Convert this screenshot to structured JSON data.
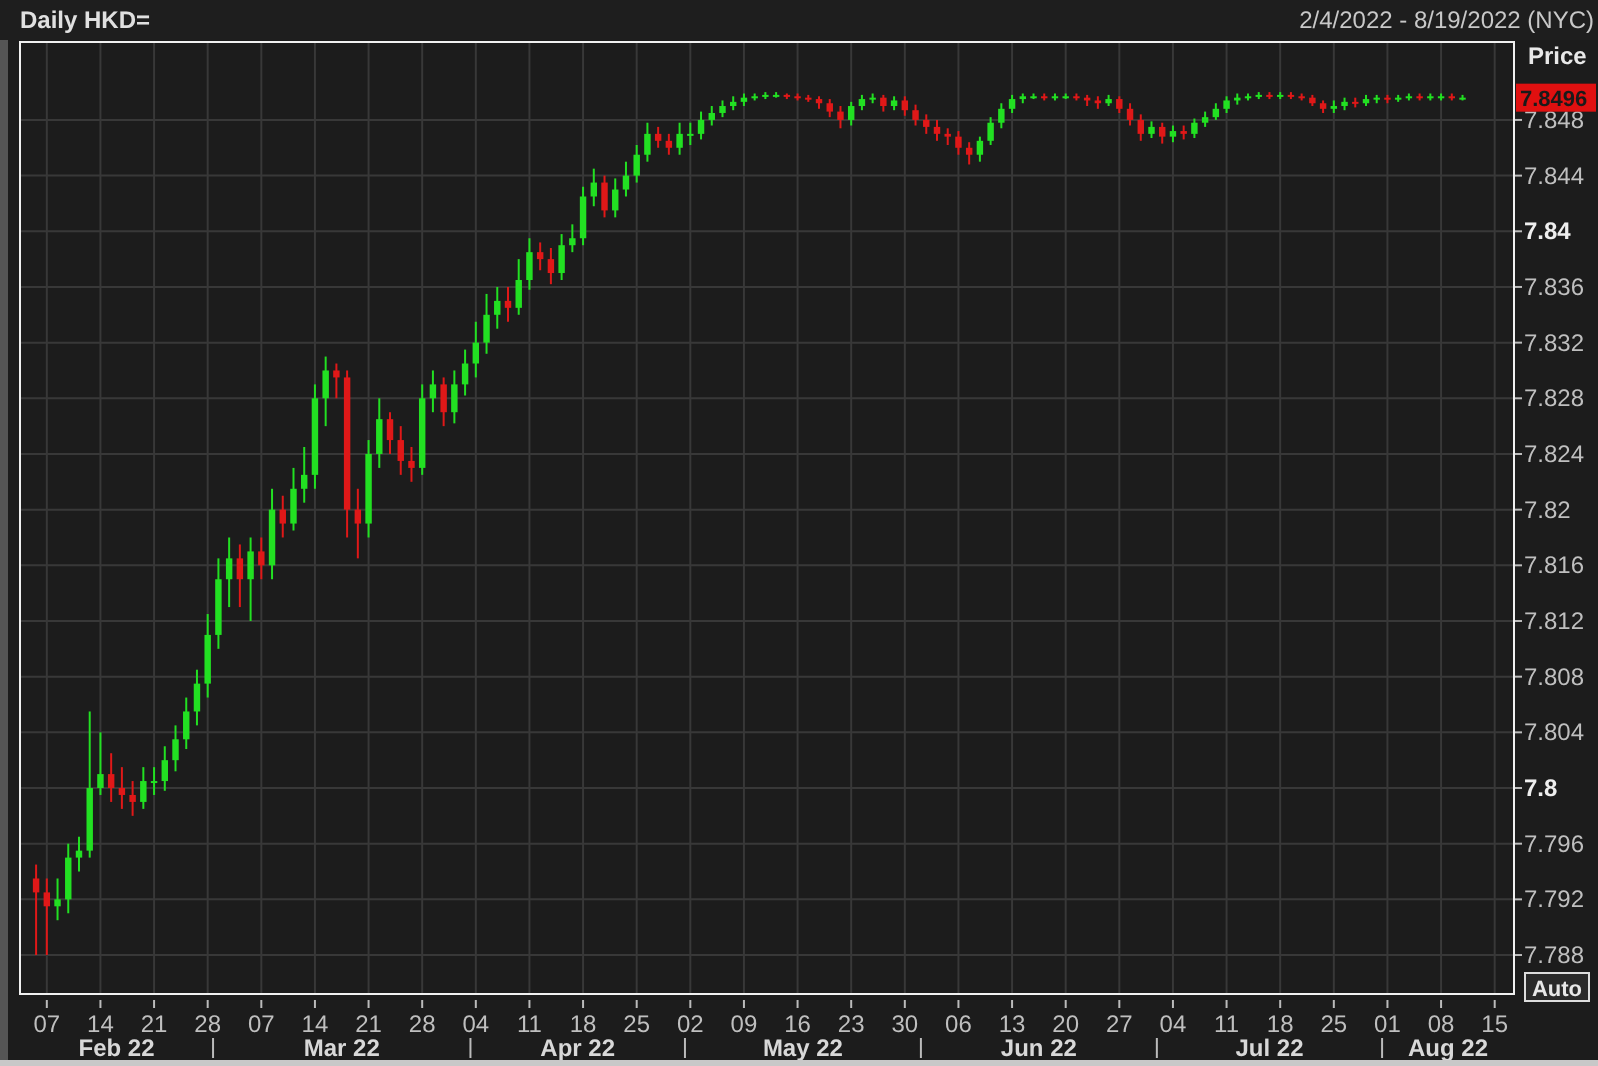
{
  "header": {
    "title": "Daily HKD=",
    "range": "2/4/2022 - 8/19/2022 (NYC)"
  },
  "chart": {
    "axis_title": "Price",
    "last_price": "7.8496",
    "auto_button": "Auto",
    "chart_data": {
      "type": "candlestick",
      "ylim": [
        7.7852,
        7.8536
      ],
      "yticks": [
        {
          "value": 7.788,
          "label": "7.788"
        },
        {
          "value": 7.792,
          "label": "7.792"
        },
        {
          "value": 7.796,
          "label": "7.796"
        },
        {
          "value": 7.8,
          "label": "7.8"
        },
        {
          "value": 7.804,
          "label": "7.804"
        },
        {
          "value": 7.808,
          "label": "7.808"
        },
        {
          "value": 7.812,
          "label": "7.812"
        },
        {
          "value": 7.816,
          "label": "7.816"
        },
        {
          "value": 7.82,
          "label": "7.82"
        },
        {
          "value": 7.824,
          "label": "7.824"
        },
        {
          "value": 7.828,
          "label": "7.828"
        },
        {
          "value": 7.832,
          "label": "7.832"
        },
        {
          "value": 7.836,
          "label": "7.836"
        },
        {
          "value": 7.84,
          "label": "7.84"
        },
        {
          "value": 7.844,
          "label": "7.844"
        },
        {
          "value": 7.848,
          "label": "7.848"
        }
      ],
      "categories": [
        null,
        "07",
        null,
        null,
        null,
        null,
        "14",
        null,
        null,
        null,
        null,
        "21",
        null,
        null,
        null,
        null,
        "28",
        null,
        null,
        null,
        null,
        "07",
        null,
        null,
        null,
        null,
        "14",
        null,
        null,
        null,
        null,
        "21",
        null,
        null,
        null,
        null,
        "28",
        null,
        null,
        null,
        null,
        "04",
        null,
        null,
        null,
        null,
        "11",
        null,
        null,
        null,
        null,
        "18",
        null,
        null,
        null,
        null,
        "25",
        null,
        null,
        null,
        null,
        "02",
        null,
        null,
        null,
        null,
        "09",
        null,
        null,
        null,
        null,
        "16",
        null,
        null,
        null,
        null,
        "23",
        null,
        null,
        null,
        null,
        "30",
        null,
        null,
        null,
        null,
        "06",
        null,
        null,
        null,
        null,
        "13",
        null,
        null,
        null,
        null,
        "20",
        null,
        null,
        null,
        null,
        "27",
        null,
        null,
        null,
        null,
        "04",
        null,
        null,
        null,
        null,
        "11",
        null,
        null,
        null,
        null,
        "18",
        null,
        null,
        null,
        null,
        "25",
        null,
        null,
        null,
        null,
        "01",
        null,
        null,
        null,
        null,
        "08",
        null,
        null,
        null,
        null,
        "15"
      ],
      "grid": true,
      "annotations": [
        "Feb 22",
        "Mar 22",
        "Apr 22",
        "May 22",
        "Jun 22",
        "Jul 22",
        "Aug 22"
      ],
      "ohlc": [
        [
          7.7935,
          7.7945,
          7.788,
          7.7925
        ],
        [
          7.7925,
          7.7935,
          7.788,
          7.7915
        ],
        [
          7.7915,
          7.7935,
          7.7905,
          7.792
        ],
        [
          7.792,
          7.796,
          7.791,
          7.795
        ],
        [
          7.795,
          7.7965,
          7.794,
          7.7955
        ],
        [
          7.7955,
          7.8055,
          7.795,
          7.8
        ],
        [
          7.8,
          7.804,
          7.7995,
          7.801
        ],
        [
          7.801,
          7.8025,
          7.799,
          7.8
        ],
        [
          7.8,
          7.8015,
          7.7985,
          7.7995
        ],
        [
          7.7995,
          7.8005,
          7.798,
          7.799
        ],
        [
          7.799,
          7.8015,
          7.7985,
          7.8005
        ],
        [
          7.8005,
          7.8015,
          7.7995,
          7.8005
        ],
        [
          7.8005,
          7.803,
          7.7998,
          7.802
        ],
        [
          7.802,
          7.8045,
          7.8012,
          7.8035
        ],
        [
          7.8035,
          7.8065,
          7.8028,
          7.8055
        ],
        [
          7.8055,
          7.8085,
          7.8045,
          7.8075
        ],
        [
          7.8075,
          7.8125,
          7.8065,
          7.811
        ],
        [
          7.811,
          7.8165,
          7.81,
          7.815
        ],
        [
          7.815,
          7.818,
          7.813,
          7.8165
        ],
        [
          7.8165,
          7.8175,
          7.813,
          7.815
        ],
        [
          7.815,
          7.818,
          7.812,
          7.817
        ],
        [
          7.817,
          7.818,
          7.815,
          7.816
        ],
        [
          7.816,
          7.8215,
          7.815,
          7.82
        ],
        [
          7.82,
          7.821,
          7.818,
          7.819
        ],
        [
          7.819,
          7.823,
          7.8185,
          7.8215
        ],
        [
          7.8215,
          7.8245,
          7.8205,
          7.8225
        ],
        [
          7.8225,
          7.829,
          7.8215,
          7.828
        ],
        [
          7.828,
          7.831,
          7.826,
          7.83
        ],
        [
          7.83,
          7.8305,
          7.828,
          7.8295
        ],
        [
          7.8295,
          7.83,
          7.818,
          7.82
        ],
        [
          7.82,
          7.8215,
          7.8165,
          7.819
        ],
        [
          7.819,
          7.825,
          7.818,
          7.824
        ],
        [
          7.824,
          7.828,
          7.823,
          7.8265
        ],
        [
          7.8265,
          7.827,
          7.824,
          7.825
        ],
        [
          7.825,
          7.826,
          7.8225,
          7.8235
        ],
        [
          7.8235,
          7.8245,
          7.822,
          7.823
        ],
        [
          7.823,
          7.829,
          7.8225,
          7.828
        ],
        [
          7.828,
          7.83,
          7.827,
          7.829
        ],
        [
          7.829,
          7.8295,
          7.826,
          7.827
        ],
        [
          7.827,
          7.83,
          7.8262,
          7.829
        ],
        [
          7.829,
          7.8315,
          7.8282,
          7.8305
        ],
        [
          7.8305,
          7.8335,
          7.8295,
          7.832
        ],
        [
          7.832,
          7.8355,
          7.8312,
          7.834
        ],
        [
          7.834,
          7.836,
          7.833,
          7.835
        ],
        [
          7.835,
          7.836,
          7.8335,
          7.8345
        ],
        [
          7.8345,
          7.838,
          7.834,
          7.8365
        ],
        [
          7.8365,
          7.8395,
          7.8358,
          7.8385
        ],
        [
          7.8385,
          7.8392,
          7.8372,
          7.838
        ],
        [
          7.838,
          7.8388,
          7.8362,
          7.837
        ],
        [
          7.837,
          7.8398,
          7.8365,
          7.839
        ],
        [
          7.839,
          7.8405,
          7.8385,
          7.8395
        ],
        [
          7.8395,
          7.8432,
          7.839,
          7.8425
        ],
        [
          7.8425,
          7.8445,
          7.8418,
          7.8435
        ],
        [
          7.8435,
          7.844,
          7.841,
          7.8415
        ],
        [
          7.8415,
          7.8438,
          7.841,
          7.843
        ],
        [
          7.843,
          7.845,
          7.8425,
          7.844
        ],
        [
          7.844,
          7.8462,
          7.8435,
          7.8455
        ],
        [
          7.8455,
          7.8478,
          7.845,
          7.847
        ],
        [
          7.847,
          7.8475,
          7.846,
          7.8465
        ],
        [
          7.8465,
          7.847,
          7.8455,
          7.846
        ],
        [
          7.846,
          7.8478,
          7.8455,
          7.847
        ],
        [
          7.847,
          7.8478,
          7.8462,
          7.847
        ],
        [
          7.847,
          7.8486,
          7.8466,
          7.848
        ],
        [
          7.848,
          7.849,
          7.8476,
          7.8485
        ],
        [
          7.8485,
          7.8494,
          7.8482,
          7.849
        ],
        [
          7.849,
          7.8497,
          7.8487,
          7.8493
        ],
        [
          7.8493,
          7.8499,
          7.849,
          7.8496
        ],
        [
          7.8496,
          7.8499,
          7.8494,
          7.8497
        ],
        [
          7.8497,
          7.85,
          7.8495,
          7.8498
        ],
        [
          7.8498,
          7.85,
          7.8496,
          7.8498
        ],
        [
          7.8498,
          7.8499,
          7.8495,
          7.8497
        ],
        [
          7.8497,
          7.8499,
          7.8494,
          7.8496
        ],
        [
          7.8496,
          7.8498,
          7.8493,
          7.8495
        ],
        [
          7.8495,
          7.8497,
          7.8488,
          7.8492
        ],
        [
          7.8492,
          7.8495,
          7.8482,
          7.8486
        ],
        [
          7.8486,
          7.849,
          7.8474,
          7.848
        ],
        [
          7.848,
          7.8493,
          7.8476,
          7.849
        ],
        [
          7.849,
          7.8498,
          7.8487,
          7.8495
        ],
        [
          7.8495,
          7.8499,
          7.8492,
          7.8496
        ],
        [
          7.8496,
          7.8498,
          7.8486,
          7.849
        ],
        [
          7.849,
          7.8497,
          7.8487,
          7.8494
        ],
        [
          7.8494,
          7.8497,
          7.8483,
          7.8487
        ],
        [
          7.8487,
          7.8491,
          7.8476,
          7.848
        ],
        [
          7.848,
          7.8484,
          7.847,
          7.8475
        ],
        [
          7.8475,
          7.848,
          7.8465,
          7.847
        ],
        [
          7.847,
          7.8474,
          7.8462,
          7.8468
        ],
        [
          7.8468,
          7.8472,
          7.8455,
          7.846
        ],
        [
          7.846,
          7.8464,
          7.8448,
          7.8455
        ],
        [
          7.8455,
          7.8468,
          7.845,
          7.8465
        ],
        [
          7.8465,
          7.8482,
          7.8462,
          7.8478
        ],
        [
          7.8478,
          7.8492,
          7.8474,
          7.8488
        ],
        [
          7.8488,
          7.8498,
          7.8485,
          7.8495
        ],
        [
          7.8495,
          7.8499,
          7.8492,
          7.8497
        ],
        [
          7.8497,
          7.8499,
          7.8495,
          7.8497
        ],
        [
          7.8497,
          7.8499,
          7.8494,
          7.8496
        ],
        [
          7.8496,
          7.8499,
          7.8494,
          7.8497
        ],
        [
          7.8497,
          7.8499,
          7.8495,
          7.8497
        ],
        [
          7.8497,
          7.8499,
          7.8494,
          7.8496
        ],
        [
          7.8496,
          7.8498,
          7.849,
          7.8494
        ],
        [
          7.8494,
          7.8497,
          7.8488,
          7.8492
        ],
        [
          7.8492,
          7.8498,
          7.849,
          7.8495
        ],
        [
          7.8495,
          7.8497,
          7.8485,
          7.8488
        ],
        [
          7.8488,
          7.8492,
          7.8476,
          7.848
        ],
        [
          7.848,
          7.8484,
          7.8465,
          7.847
        ],
        [
          7.847,
          7.8479,
          7.8467,
          7.8475
        ],
        [
          7.8475,
          7.8478,
          7.8463,
          7.8468
        ],
        [
          7.8468,
          7.8476,
          7.8464,
          7.8472
        ],
        [
          7.8472,
          7.8476,
          7.8466,
          7.847
        ],
        [
          7.847,
          7.8481,
          7.8467,
          7.8478
        ],
        [
          7.8478,
          7.8486,
          7.8475,
          7.8482
        ],
        [
          7.8482,
          7.8492,
          7.848,
          7.8488
        ],
        [
          7.8488,
          7.8497,
          7.8485,
          7.8494
        ],
        [
          7.8494,
          7.8499,
          7.8491,
          7.8496
        ],
        [
          7.8496,
          7.8499,
          7.8494,
          7.8497
        ],
        [
          7.8497,
          7.85,
          7.8495,
          7.8498
        ],
        [
          7.8498,
          7.85,
          7.8495,
          7.8497
        ],
        [
          7.8497,
          7.85,
          7.8495,
          7.8498
        ],
        [
          7.8498,
          7.85,
          7.8495,
          7.8497
        ],
        [
          7.8497,
          7.8499,
          7.8494,
          7.8496
        ],
        [
          7.8496,
          7.8498,
          7.849,
          7.8492
        ],
        [
          7.8492,
          7.8494,
          7.8485,
          7.8488
        ],
        [
          7.8488,
          7.8494,
          7.8485,
          7.849
        ],
        [
          7.849,
          7.8496,
          7.8487,
          7.8493
        ],
        [
          7.8493,
          7.8496,
          7.8489,
          7.8492
        ],
        [
          7.8492,
          7.8498,
          7.849,
          7.8495
        ],
        [
          7.8495,
          7.8498,
          7.8492,
          7.8496
        ],
        [
          7.8496,
          7.8498,
          7.8492,
          7.8495
        ],
        [
          7.8495,
          7.8498,
          7.8493,
          7.8496
        ],
        [
          7.8496,
          7.8499,
          7.8494,
          7.8497
        ],
        [
          7.8497,
          7.8499,
          7.8494,
          7.8496
        ],
        [
          7.8496,
          7.8499,
          7.8494,
          7.8497
        ],
        [
          7.8497,
          7.8499,
          7.8494,
          7.8497
        ],
        [
          7.8497,
          7.8499,
          7.8494,
          7.8496
        ],
        [
          7.8496,
          7.8498,
          7.8494,
          7.8496
        ],
        null,
        null,
        null
      ]
    }
  }
}
